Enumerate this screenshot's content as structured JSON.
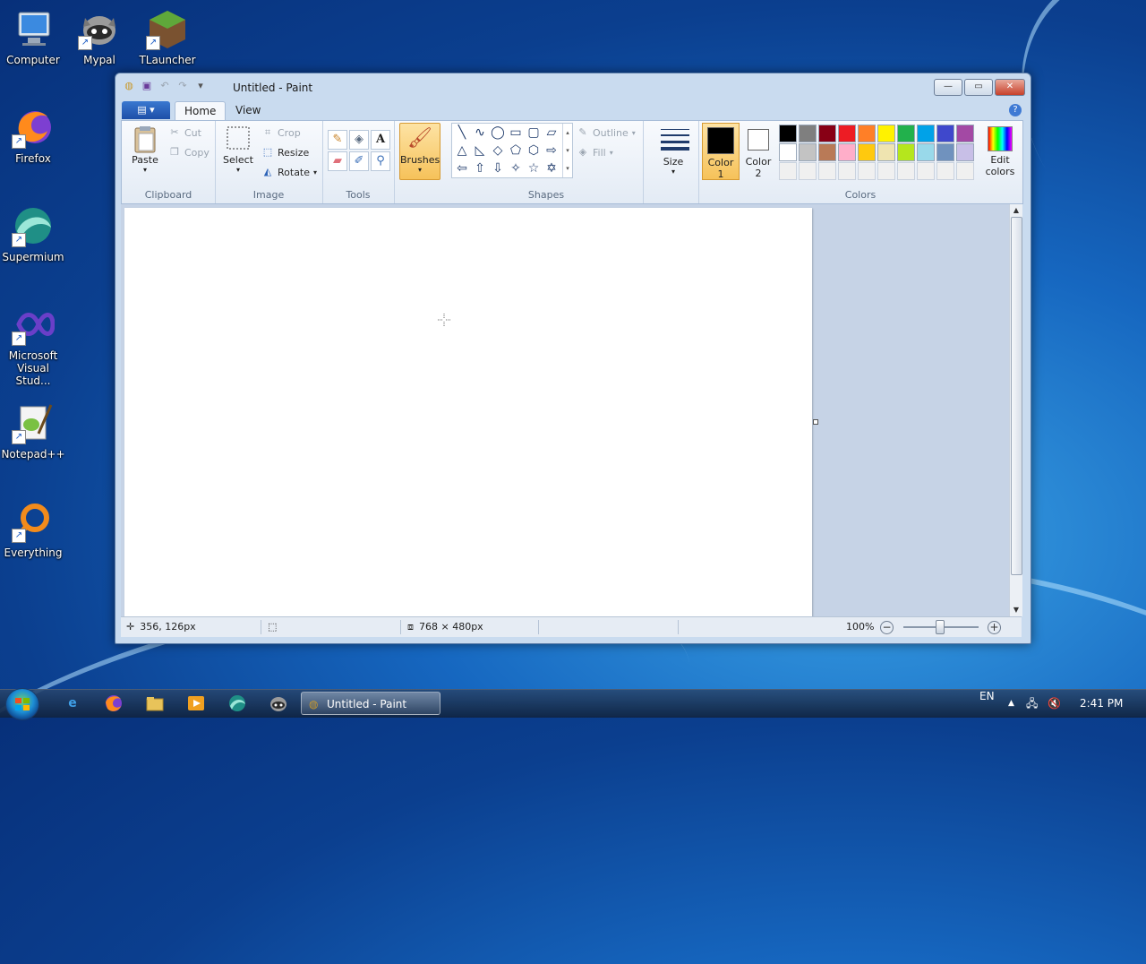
{
  "desktop": {
    "icons": [
      {
        "label": "Computer",
        "icon": "computer-icon"
      },
      {
        "label": "Mypal",
        "icon": "mypal-icon"
      },
      {
        "label": "TLauncher",
        "icon": "tlauncher-icon"
      },
      {
        "label": "Firefox",
        "icon": "firefox-icon"
      },
      {
        "label": "Supermium",
        "icon": "supermium-icon"
      },
      {
        "label": "Microsoft Visual Stud...",
        "icon": "visual-studio-icon"
      },
      {
        "label": "Notepad++",
        "icon": "notepadpp-icon"
      },
      {
        "label": "Everything",
        "icon": "everything-icon"
      }
    ]
  },
  "window": {
    "title": "Untitled - Paint",
    "buttons": {
      "minimize": "—",
      "maximize": "▭",
      "close": "✕"
    }
  },
  "tabs": {
    "file": "▤ ▾",
    "home": "Home",
    "view": "View"
  },
  "ribbon": {
    "clipboard": {
      "label": "Clipboard",
      "paste": "Paste",
      "cut": "Cut",
      "copy": "Copy"
    },
    "image": {
      "label": "Image",
      "select": "Select",
      "crop": "Crop",
      "resize": "Resize",
      "rotate": "Rotate"
    },
    "tools": {
      "label": "Tools"
    },
    "brushes": {
      "label": "Brushes"
    },
    "shapes": {
      "label": "Shapes",
      "outline": "Outline",
      "fill": "Fill"
    },
    "size": {
      "label": "Size"
    },
    "colors": {
      "label": "Colors",
      "color1_line1": "Color",
      "color1_line2": "1",
      "color2_line1": "Color",
      "color2_line2": "2",
      "edit_line1": "Edit",
      "edit_line2": "colors",
      "color1_value": "#000000",
      "color2_value": "#ffffff",
      "palette_row1": [
        "#000000",
        "#7f7f7f",
        "#880015",
        "#ed1c24",
        "#ff7f27",
        "#fff200",
        "#22b14c",
        "#00a2e8",
        "#3f48cc",
        "#a349a4"
      ],
      "palette_row2": [
        "#ffffff",
        "#c3c3c3",
        "#b97a57",
        "#ffaec9",
        "#ffc90e",
        "#efe4b0",
        "#b5e61d",
        "#99d9ea",
        "#7092be",
        "#c8bfe7"
      ],
      "palette_row3": [
        "#f0f0f0",
        "#f0f0f0",
        "#f0f0f0",
        "#f0f0f0",
        "#f0f0f0",
        "#f0f0f0",
        "#f0f0f0",
        "#f0f0f0",
        "#f0f0f0",
        "#f0f0f0"
      ]
    }
  },
  "status": {
    "cursor_pos": "356, 126px",
    "canvas_size": "768 × 480px",
    "zoom": "100%"
  },
  "taskbar": {
    "task_label": "Untitled - Paint",
    "lang": "EN",
    "time": "2:41 PM"
  }
}
